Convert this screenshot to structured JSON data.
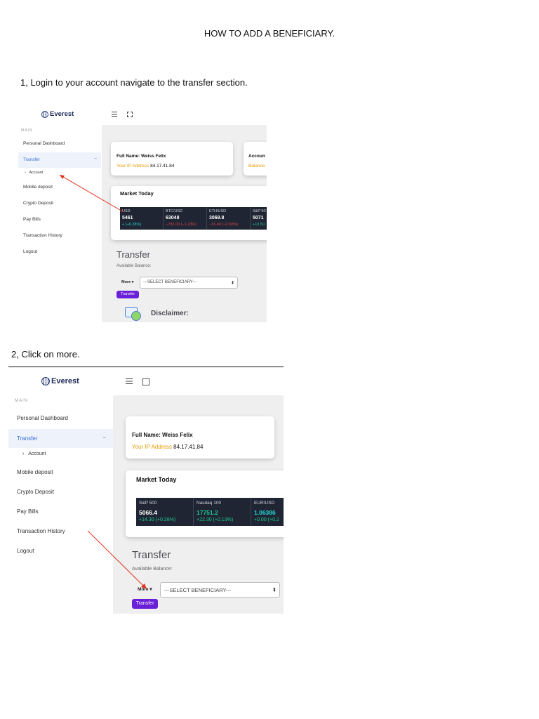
{
  "document": {
    "title": "HOW TO ADD A BENEFICIARY.",
    "step1": "1, Login to your account navigate to the transfer section.",
    "step2": "2, Click on more."
  },
  "app": {
    "brand": "Everest",
    "main_label": "MAIN",
    "nav": {
      "personal_dashboard": "Personal Dashboard",
      "transfer": "Transfer",
      "transfer_toggle": "−",
      "account": "Account",
      "mobile_deposit": "Mobile deposit",
      "crypto_deposit": "Crypto Deposit",
      "pay_bills": "Pay Bills",
      "transaction_history": "Transaction History",
      "logout": "Logout"
    },
    "profile": {
      "full_name": "Full Name: Weiss Felix",
      "ip_label": "Your IP Address",
      "ip_value": "84.17.41.84"
    },
    "account_card": {
      "title_partial": "Accoun",
      "balance_partial": "Balance"
    },
    "market_title": "Market Today",
    "transfer_heading": "Transfer",
    "available_balance": "Available Balance:",
    "more_label": "More",
    "select_placeholder": "---SELECT BENEFICIARY---",
    "transfer_button": "Transfer",
    "disclaimer": "Disclaimer:",
    "colors": {
      "accent_purple": "#6a1fd8",
      "active_blue": "#3b6fd8",
      "ip_orange": "#e69a00",
      "ticker_bg": "#1f2532",
      "up_green": "#1fc995",
      "down_red": "#e2434b",
      "annotation_red": "#e2311d"
    }
  },
  "tickers1": [
    {
      "symbol": "USD",
      "value": "5461",
      "change": "+ (+0.28%)",
      "dir": "cyan"
    },
    {
      "symbol": "BTC/USD",
      "value": "63048",
      "change": "−782.00 (−1.23%)",
      "dir": "down"
    },
    {
      "symbol": "ETH/USD",
      "value": "3069.8",
      "change": "−16.40 (−0.50%)",
      "dir": "down"
    },
    {
      "symbol": "S&P 50",
      "value": "5071",
      "change": "+19.50",
      "dir": "up"
    }
  ],
  "tickers2": [
    {
      "symbol": "S&P 500",
      "value": "5066.4",
      "change": "+14.30 (+0.28%)",
      "dir": "up"
    },
    {
      "symbol": "Nasdaq 100",
      "value": "17751.2",
      "change": "+22.30 (+0.13%)",
      "dir": "up"
    },
    {
      "symbol": "EUR/USD",
      "value": "1.06386",
      "change": "+0.00 (+0.2",
      "dir": "up"
    }
  ]
}
